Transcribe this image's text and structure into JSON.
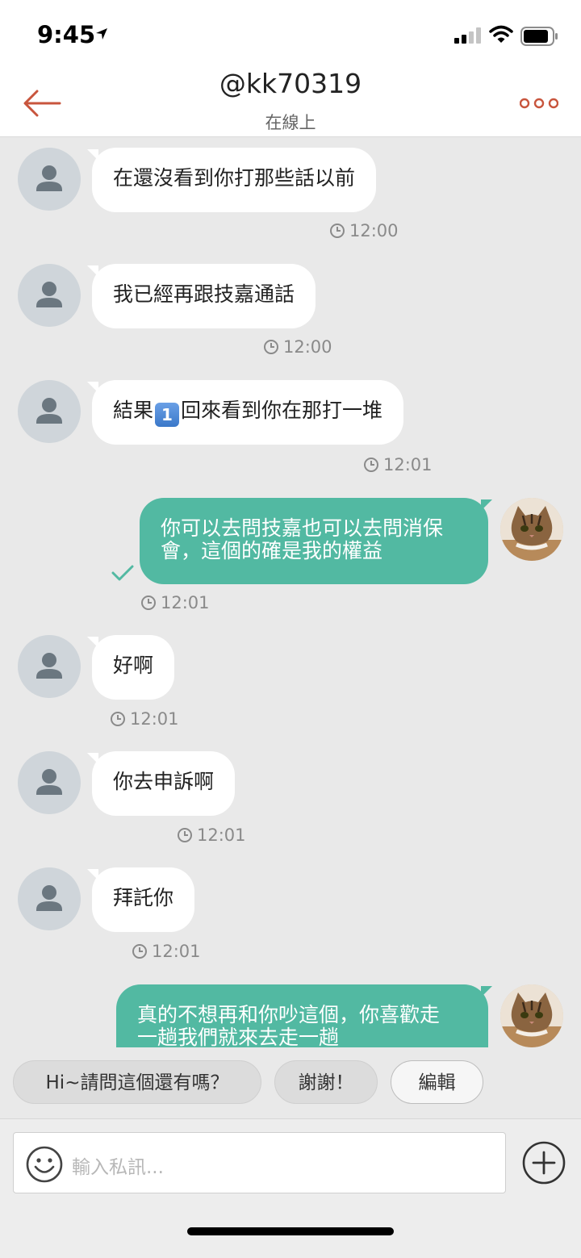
{
  "status_bar": {
    "time": "9:45"
  },
  "header": {
    "title": "@kk70319",
    "subtitle": "在線上"
  },
  "messages": [
    {
      "text": "在還沒看到你打那些話以前",
      "time": "12:00"
    },
    {
      "text": "我已經再跟技嘉通話",
      "time": "12:00"
    },
    {
      "text_before": "結果",
      "keycap": "1",
      "text_after": "回來看到你在那打一堆",
      "time": "12:01"
    },
    {
      "line1": "你可以去問技嘉也可以去問消保",
      "line2": "會，這個的確是我的權益",
      "time": "12:01"
    },
    {
      "text": "好啊",
      "time": "12:01"
    },
    {
      "text": "你去申訴啊",
      "time": "12:01"
    },
    {
      "text": "拜託你",
      "time": "12:01"
    },
    {
      "line1": "真的不想再和你吵這個，你喜歡走",
      "line2": "一趟我們就來去走一趟"
    }
  ],
  "quick_replies": [
    "Hi~請問這個還有嗎？",
    "謝謝！",
    "編輯"
  ],
  "composer": {
    "placeholder": "輸入私訊..."
  },
  "colors": {
    "accent": "#c8553d",
    "bubble_out": "#52b9a2",
    "bubble_in": "#ffffff",
    "background": "#e9e9e9"
  }
}
